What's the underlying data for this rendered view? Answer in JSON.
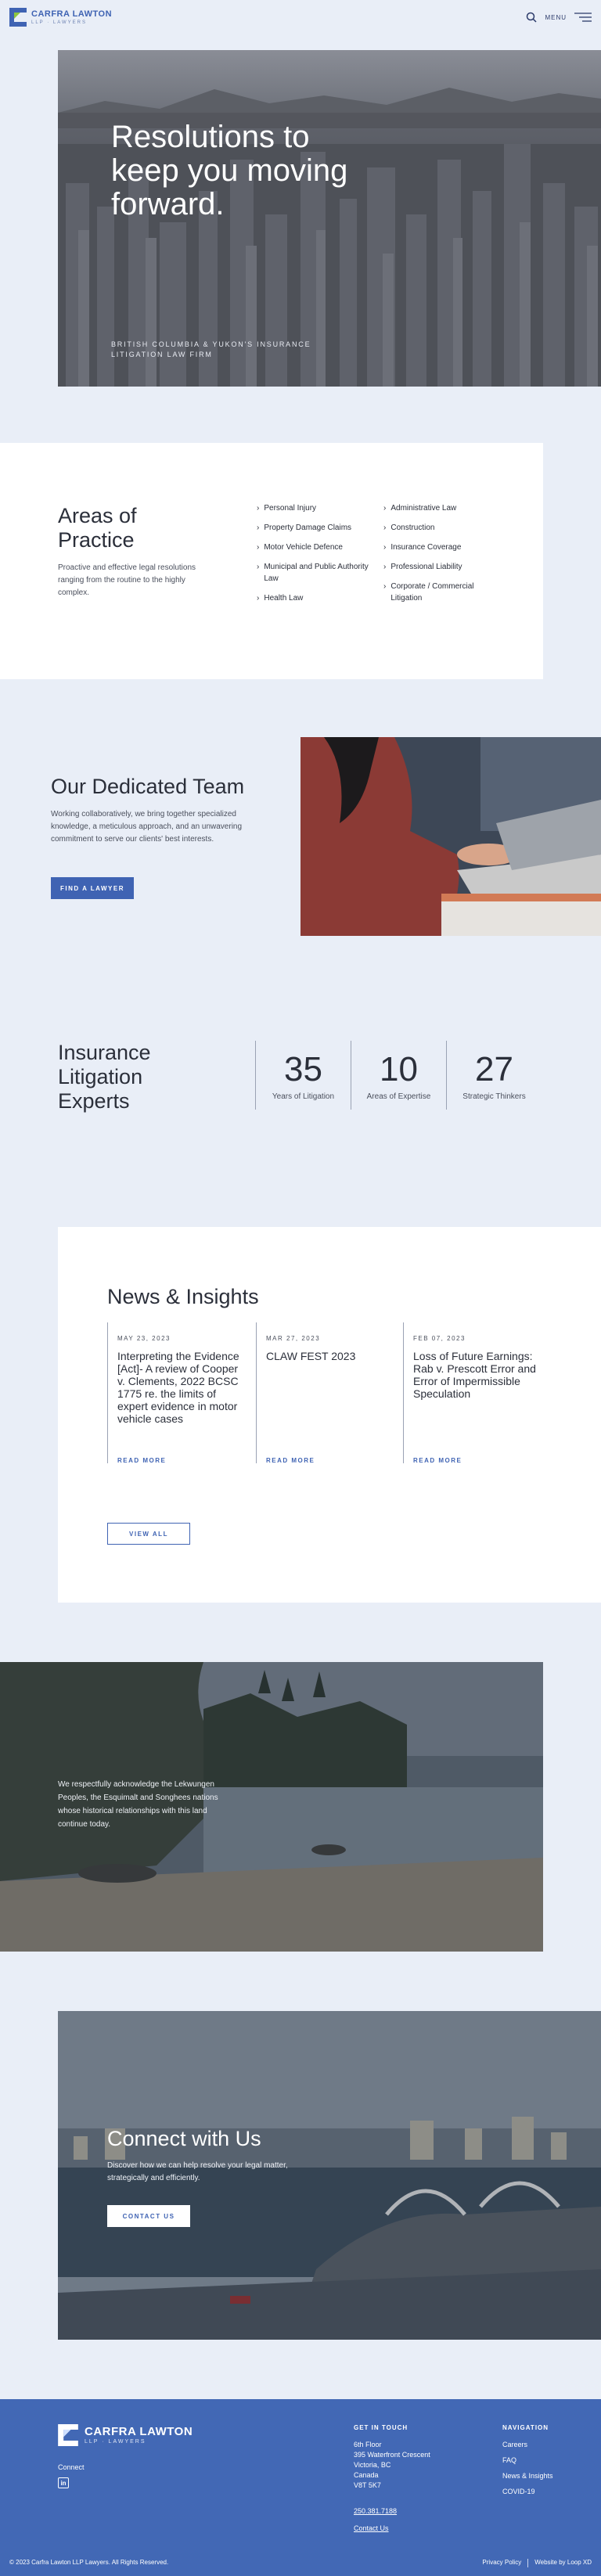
{
  "header": {
    "logo_name": "CARFRA LAWTON",
    "logo_sub": "LLP · LAWYERS",
    "menu_label": "MENU",
    "icons": {
      "search": "search-icon",
      "menu": "hamburger-icon"
    }
  },
  "hero": {
    "title": "Resolutions to keep you moving forward.",
    "subtitle": "BRITISH COLUMBIA & YUKON'S INSURANCE LITIGATION LAW FIRM"
  },
  "areas": {
    "title": "Areas of Practice",
    "description": "Proactive and effective legal resolutions ranging from the routine to the highly complex.",
    "left": [
      "Personal Injury",
      "Property Damage Claims",
      "Motor Vehicle Defence",
      "Municipal and Public Authority Law",
      "Health Law"
    ],
    "right": [
      "Administrative Law",
      "Construction",
      "Insurance Coverage",
      "Professional Liability",
      "Corporate / Commercial Litigation"
    ]
  },
  "team": {
    "title": "Our Dedicated Team",
    "description": "Working collaboratively, we bring together specialized knowledge, a meticulous approach, and an unwavering commitment to serve our clients' best interests.",
    "button": "FIND A LAWYER"
  },
  "stats": {
    "title": "Insurance Litigation Experts",
    "items": [
      {
        "num": "35",
        "label": "Years of Litigation"
      },
      {
        "num": "10",
        "label": "Areas of Expertise"
      },
      {
        "num": "27",
        "label": "Strategic Thinkers"
      }
    ]
  },
  "news": {
    "title": "News & Insights",
    "read_more": "READ MORE",
    "view_all": "VIEW ALL",
    "items": [
      {
        "date": "MAY 23, 2023",
        "title": "Interpreting the Evidence [Act]- A review of Cooper v. Clements, 2022 BCSC 1775 re. the limits of expert evidence in motor vehicle cases"
      },
      {
        "date": "MAR 27, 2023",
        "title": "CLAW FEST 2023"
      },
      {
        "date": "FEB 07, 2023",
        "title": "Loss of Future Earnings: Rab v. Prescott Error and Error of Impermissible Speculation"
      }
    ]
  },
  "acknowledgement": {
    "text": "We respectfully acknowledge the Lekwungen Peoples, the Esquimalt and Songhees nations whose historical relationships with this land continue today."
  },
  "connect": {
    "title": "Connect with Us",
    "description": "Discover how we can help resolve your legal matter, strategically and efficiently.",
    "button": "CONTACT US"
  },
  "footer": {
    "logo_name": "CARFRA LAWTON",
    "logo_sub": "LLP · LAWYERS",
    "connect_label": "Connect",
    "linkedin": "in",
    "get_in_touch": "GET IN TOUCH",
    "address": [
      "6th Floor",
      "395 Waterfront Crescent",
      "Victoria, BC",
      "Canada",
      "V8T 5K7"
    ],
    "phone": "250.381.7188",
    "contact_link": "Contact Us",
    "navigation_head": "NAVIGATION",
    "nav": [
      "Careers",
      "FAQ",
      "News & Insights",
      "COVID-19"
    ],
    "copyright": "© 2023 Carfra Lawton LLP Lawyers. All Rights Reserved.",
    "privacy": "Privacy Policy",
    "credit": "Website by Loop XD"
  },
  "colors": {
    "accent": "#3f63b3",
    "footer": "#4268b5",
    "background": "#e9eef7"
  }
}
